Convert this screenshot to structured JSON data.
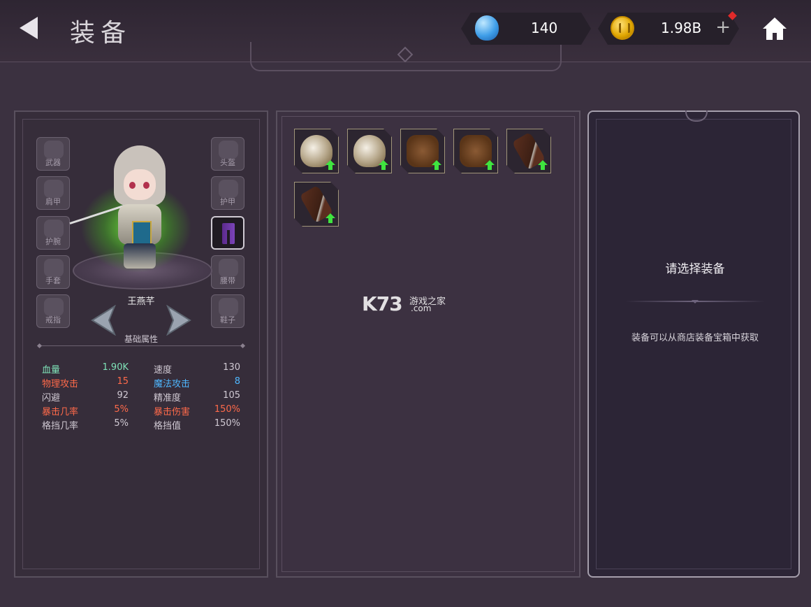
{
  "header": {
    "title": "装备",
    "gems": "140",
    "gold": "1.98B",
    "plus": "+"
  },
  "hero": {
    "name": "王燕芊",
    "section": "基础属性"
  },
  "slots": [
    {
      "label": "武器"
    },
    {
      "label": "肩甲"
    },
    {
      "label": "护腕"
    },
    {
      "label": "手套"
    },
    {
      "label": "戒指"
    },
    {
      "label": "头盔"
    },
    {
      "label": "护甲"
    },
    {
      "label": ""
    },
    {
      "label": "腰带"
    },
    {
      "label": "鞋子"
    }
  ],
  "stats": [
    {
      "k": "血量",
      "v": "1.90K",
      "k2": "速度",
      "v2": "130"
    },
    {
      "k": "物理攻击",
      "v": "15",
      "k2": "魔法攻击",
      "v2": "8"
    },
    {
      "k": "闪避",
      "v": "92",
      "k2": "精准度",
      "v2": "105"
    },
    {
      "k": "暴击几率",
      "v": "5%",
      "k2": "暴击伤害",
      "v2": "150%"
    },
    {
      "k": "格挡几率",
      "v": "5%",
      "k2": "格挡值",
      "v2": "150%"
    }
  ],
  "colors": {
    "hp": "#7fe3b8",
    "phys": "#ff6a4a",
    "magic": "#4fb7ff",
    "crit": "#ff6a4a",
    "normal": "#d0c9d3"
  },
  "watermark": {
    "logo": "K73",
    "site": "游戏之家",
    "tld": ".com"
  },
  "detail": {
    "title": "请选择装备",
    "hint": "装备可以从商店装备宝箱中获取"
  }
}
